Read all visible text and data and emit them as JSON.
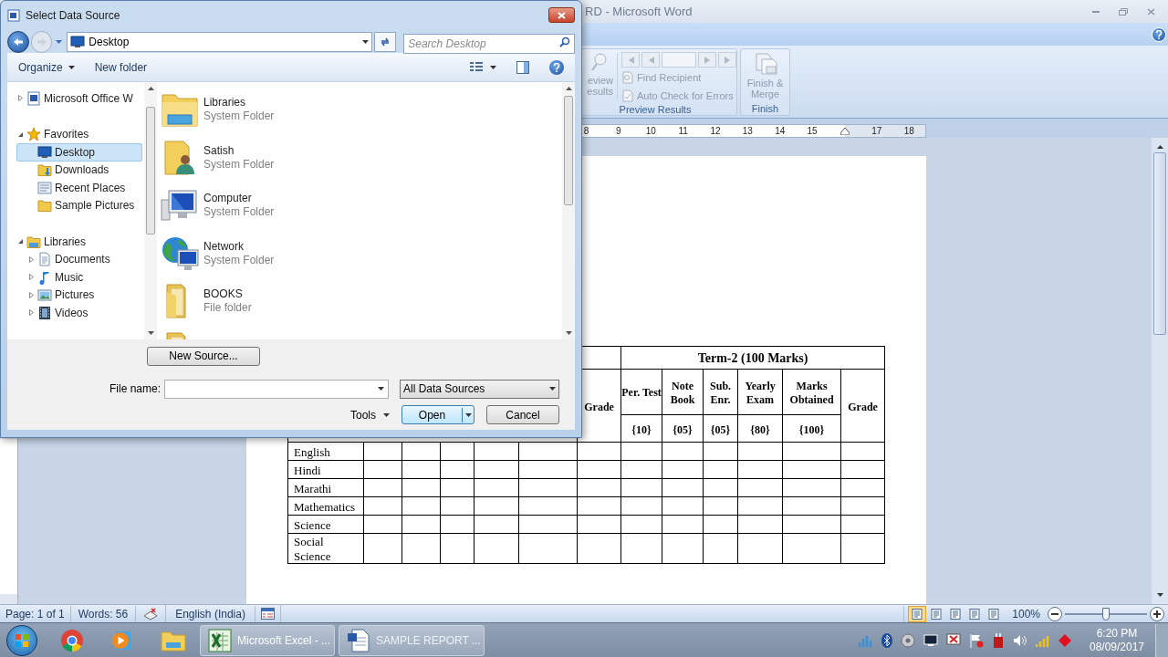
{
  "word_window": {
    "title": "RD - Microsoft Word"
  },
  "ribbon": {
    "cut_button": [
      "eview",
      "esults"
    ],
    "groups": [
      {
        "label": "Preview Results",
        "commands": [
          {
            "label": "Find Recipient",
            "disabled": true
          },
          {
            "label": "Auto Check for Errors",
            "disabled": true
          }
        ]
      },
      {
        "label": "Finish",
        "commands": [
          {
            "label": "Finish & Merge",
            "disabled": true
          }
        ]
      }
    ]
  },
  "ruler": {
    "numbers": [
      "8",
      "9",
      "10",
      "11",
      "12",
      "13",
      "14",
      "15"
    ],
    "numbers_after_marker": [
      "17",
      "18"
    ]
  },
  "table": {
    "grade_heading": "Grade",
    "term_heading": "Term-2 (100 Marks)",
    "columns": [
      {
        "label": "Per. Test",
        "max": "{10}"
      },
      {
        "label": "Note Book",
        "max": "{05}"
      },
      {
        "label": "Sub. Enr.",
        "max": "{05}"
      },
      {
        "label": "Yearly Exam",
        "max": "{80}"
      },
      {
        "label": "Marks Obtained",
        "max": "{100}"
      }
    ],
    "last_heading": "Grade",
    "subjects": [
      "English",
      "Hindi",
      "Marathi",
      "Mathematics",
      "Science",
      "Social Science"
    ]
  },
  "status_bar": {
    "page": "Page: 1 of 1",
    "words": "Words: 56",
    "language": "English (India)",
    "views": [
      {
        "selected": true
      },
      {
        "selected": false
      },
      {
        "selected": false
      },
      {
        "selected": false
      },
      {
        "selected": false
      }
    ],
    "zoom": {
      "label": "100%",
      "level": 0.5
    }
  },
  "taskbar": {
    "buttons": [
      {
        "label": "Microsoft Excel - ...",
        "kind": "spreadsheet"
      },
      {
        "label": "SAMPLE REPORT ...",
        "kind": "document"
      }
    ],
    "time": "6:20 PM",
    "date": "08/09/2017"
  },
  "dialog": {
    "title": "Select Data Source",
    "address": "Desktop",
    "search_placeholder": "Search Desktop",
    "toolbar": {
      "organize": "Organize",
      "new_folder": "New folder"
    },
    "nav": [
      {
        "label": "Microsoft Office W",
        "kind": "office",
        "expanded": false,
        "selected": false
      },
      {
        "label": "Favorites",
        "kind": "star",
        "expanded": true,
        "selected": false,
        "children": [
          {
            "label": "Desktop",
            "kind": "desktop",
            "selected": true
          },
          {
            "label": "Downloads",
            "kind": "downloads",
            "selected": false
          },
          {
            "label": "Recent Places",
            "kind": "recent",
            "selected": false
          },
          {
            "label": "Sample Pictures",
            "kind": "folder",
            "selected": false
          }
        ]
      },
      {
        "label": "Libraries",
        "kind": "library",
        "expanded": true,
        "selected": false,
        "children": [
          {
            "label": "Documents",
            "kind": "document",
            "expanded": false,
            "selected": false
          },
          {
            "label": "Music",
            "kind": "music",
            "expanded": false,
            "selected": false
          },
          {
            "label": "Pictures",
            "kind": "picture",
            "expanded": false,
            "selected": false
          },
          {
            "label": "Videos",
            "kind": "video",
            "expanded": false,
            "selected": false
          }
        ]
      }
    ],
    "files": [
      {
        "name": "Libraries",
        "type": "System Folder",
        "kind": "libraries"
      },
      {
        "name": "Satish",
        "type": "System Folder",
        "kind": "user-folder"
      },
      {
        "name": "Computer",
        "type": "System Folder",
        "kind": "computer"
      },
      {
        "name": "Network",
        "type": "System Folder",
        "kind": "network"
      },
      {
        "name": "BOOKS",
        "type": "File folder",
        "kind": "folder"
      },
      {
        "kind": "folder"
      }
    ],
    "new_source": "New Source...",
    "file_name_label": "File name:",
    "file_type": "All Data Sources",
    "tools": "Tools",
    "open": "Open",
    "cancel": "Cancel"
  }
}
